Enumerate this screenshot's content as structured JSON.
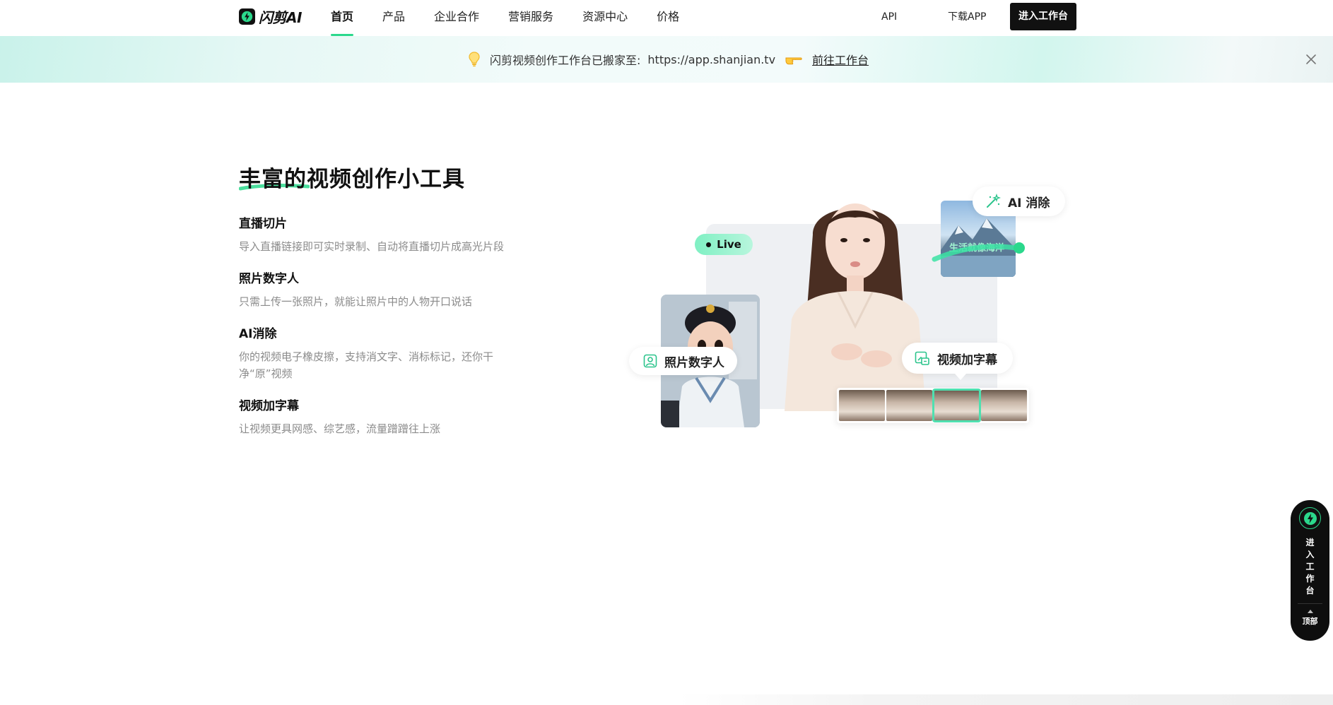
{
  "nav": {
    "logo_text": "闪剪AI",
    "items": [
      {
        "label": "首页",
        "active": true
      },
      {
        "label": "产品",
        "active": false
      },
      {
        "label": "企业合作",
        "active": false
      },
      {
        "label": "营销服务",
        "active": false
      },
      {
        "label": "资源中心",
        "active": false
      },
      {
        "label": "价格",
        "active": false
      }
    ],
    "api_label": "API",
    "download_label": "下载APP",
    "enter_label": "进入工作台"
  },
  "banner": {
    "message": "闪剪视频创作工作台已搬家至:",
    "url": "https://app.shanjian.tv",
    "link_label": "前往工作台"
  },
  "section": {
    "title": "丰富的视频创作小工具",
    "features": [
      {
        "title": "直播切片",
        "desc": "导入直播链接即可实时录制、自动将直播切片成高光片段"
      },
      {
        "title": "照片数字人",
        "desc": "只需上传一张照片，就能让照片中的人物开口说话"
      },
      {
        "title": "AI消除",
        "desc": "你的视频电子橡皮擦，支持消文字、消标标记，还你干净“原”视频"
      },
      {
        "title": "视频加字幕",
        "desc": "让视频更具网感、综艺感，流量蹭蹭往上涨"
      }
    ]
  },
  "illustration": {
    "live_label": "Live",
    "ai_remove_label": "AI 消除",
    "subtitle_label": "视频加字幕",
    "photo_human_label": "照片数字人",
    "scene_caption": "生活就像海洋"
  },
  "side_widget": {
    "enter_chars": [
      "进",
      "入",
      "工",
      "作",
      "台"
    ],
    "top_label": "顶部"
  },
  "colors": {
    "accent": "#2bd88c",
    "dark": "#111111"
  }
}
